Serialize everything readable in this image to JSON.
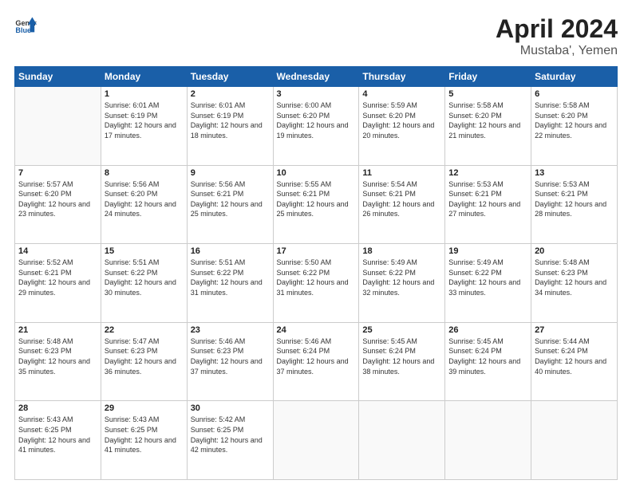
{
  "header": {
    "logo": {
      "general": "General",
      "blue": "Blue"
    },
    "title": "April 2024",
    "location": "Mustaba', Yemen"
  },
  "calendar": {
    "weekdays": [
      "Sunday",
      "Monday",
      "Tuesday",
      "Wednesday",
      "Thursday",
      "Friday",
      "Saturday"
    ],
    "weeks": [
      [
        {
          "day": null
        },
        {
          "day": "1",
          "sunrise": "6:01 AM",
          "sunset": "6:19 PM",
          "daylight": "12 hours and 17 minutes."
        },
        {
          "day": "2",
          "sunrise": "6:01 AM",
          "sunset": "6:19 PM",
          "daylight": "12 hours and 18 minutes."
        },
        {
          "day": "3",
          "sunrise": "6:00 AM",
          "sunset": "6:20 PM",
          "daylight": "12 hours and 19 minutes."
        },
        {
          "day": "4",
          "sunrise": "5:59 AM",
          "sunset": "6:20 PM",
          "daylight": "12 hours and 20 minutes."
        },
        {
          "day": "5",
          "sunrise": "5:58 AM",
          "sunset": "6:20 PM",
          "daylight": "12 hours and 21 minutes."
        },
        {
          "day": "6",
          "sunrise": "5:58 AM",
          "sunset": "6:20 PM",
          "daylight": "12 hours and 22 minutes."
        }
      ],
      [
        {
          "day": "7",
          "sunrise": "5:57 AM",
          "sunset": "6:20 PM",
          "daylight": "12 hours and 23 minutes."
        },
        {
          "day": "8",
          "sunrise": "5:56 AM",
          "sunset": "6:20 PM",
          "daylight": "12 hours and 24 minutes."
        },
        {
          "day": "9",
          "sunrise": "5:56 AM",
          "sunset": "6:21 PM",
          "daylight": "12 hours and 25 minutes."
        },
        {
          "day": "10",
          "sunrise": "5:55 AM",
          "sunset": "6:21 PM",
          "daylight": "12 hours and 25 minutes."
        },
        {
          "day": "11",
          "sunrise": "5:54 AM",
          "sunset": "6:21 PM",
          "daylight": "12 hours and 26 minutes."
        },
        {
          "day": "12",
          "sunrise": "5:53 AM",
          "sunset": "6:21 PM",
          "daylight": "12 hours and 27 minutes."
        },
        {
          "day": "13",
          "sunrise": "5:53 AM",
          "sunset": "6:21 PM",
          "daylight": "12 hours and 28 minutes."
        }
      ],
      [
        {
          "day": "14",
          "sunrise": "5:52 AM",
          "sunset": "6:21 PM",
          "daylight": "12 hours and 29 minutes."
        },
        {
          "day": "15",
          "sunrise": "5:51 AM",
          "sunset": "6:22 PM",
          "daylight": "12 hours and 30 minutes."
        },
        {
          "day": "16",
          "sunrise": "5:51 AM",
          "sunset": "6:22 PM",
          "daylight": "12 hours and 31 minutes."
        },
        {
          "day": "17",
          "sunrise": "5:50 AM",
          "sunset": "6:22 PM",
          "daylight": "12 hours and 31 minutes."
        },
        {
          "day": "18",
          "sunrise": "5:49 AM",
          "sunset": "6:22 PM",
          "daylight": "12 hours and 32 minutes."
        },
        {
          "day": "19",
          "sunrise": "5:49 AM",
          "sunset": "6:22 PM",
          "daylight": "12 hours and 33 minutes."
        },
        {
          "day": "20",
          "sunrise": "5:48 AM",
          "sunset": "6:23 PM",
          "daylight": "12 hours and 34 minutes."
        }
      ],
      [
        {
          "day": "21",
          "sunrise": "5:48 AM",
          "sunset": "6:23 PM",
          "daylight": "12 hours and 35 minutes."
        },
        {
          "day": "22",
          "sunrise": "5:47 AM",
          "sunset": "6:23 PM",
          "daylight": "12 hours and 36 minutes."
        },
        {
          "day": "23",
          "sunrise": "5:46 AM",
          "sunset": "6:23 PM",
          "daylight": "12 hours and 37 minutes."
        },
        {
          "day": "24",
          "sunrise": "5:46 AM",
          "sunset": "6:24 PM",
          "daylight": "12 hours and 37 minutes."
        },
        {
          "day": "25",
          "sunrise": "5:45 AM",
          "sunset": "6:24 PM",
          "daylight": "12 hours and 38 minutes."
        },
        {
          "day": "26",
          "sunrise": "5:45 AM",
          "sunset": "6:24 PM",
          "daylight": "12 hours and 39 minutes."
        },
        {
          "day": "27",
          "sunrise": "5:44 AM",
          "sunset": "6:24 PM",
          "daylight": "12 hours and 40 minutes."
        }
      ],
      [
        {
          "day": "28",
          "sunrise": "5:43 AM",
          "sunset": "6:25 PM",
          "daylight": "12 hours and 41 minutes."
        },
        {
          "day": "29",
          "sunrise": "5:43 AM",
          "sunset": "6:25 PM",
          "daylight": "12 hours and 41 minutes."
        },
        {
          "day": "30",
          "sunrise": "5:42 AM",
          "sunset": "6:25 PM",
          "daylight": "12 hours and 42 minutes."
        },
        {
          "day": null
        },
        {
          "day": null
        },
        {
          "day": null
        },
        {
          "day": null
        }
      ]
    ]
  }
}
